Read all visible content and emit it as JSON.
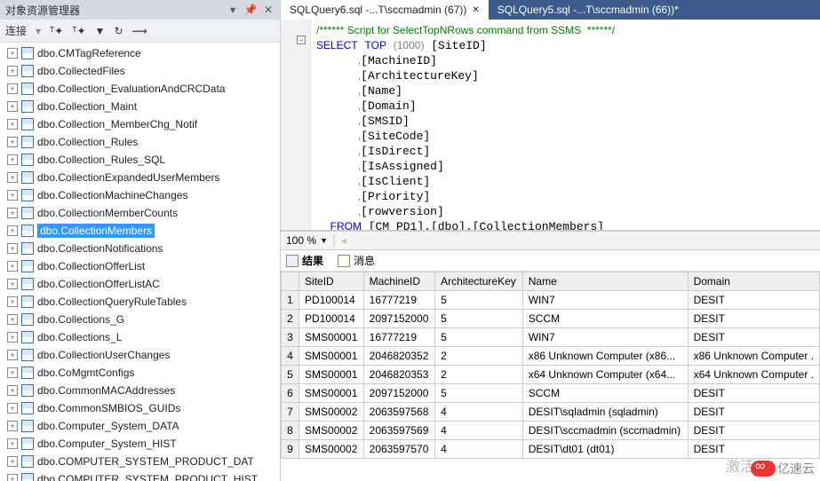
{
  "sidebar": {
    "title": "对象资源管理器",
    "connect_label": "连接",
    "items": [
      "dbo.CMTagReference",
      "dbo.CollectedFiles",
      "dbo.Collection_EvaluationAndCRCData",
      "dbo.Collection_Maint",
      "dbo.Collection_MemberChg_Notif",
      "dbo.Collection_Rules",
      "dbo.Collection_Rules_SQL",
      "dbo.CollectionExpandedUserMembers",
      "dbo.CollectionMachineChanges",
      "dbo.CollectionMemberCounts",
      "dbo.CollectionMembers",
      "dbo.CollectionNotifications",
      "dbo.CollectionOfferList",
      "dbo.CollectionOfferListAC",
      "dbo.CollectionQueryRuleTables",
      "dbo.Collections_G",
      "dbo.Collections_L",
      "dbo.CollectionUserChanges",
      "dbo.CoMgmtConfigs",
      "dbo.CommonMACAddresses",
      "dbo.CommonSMBIOS_GUIDs",
      "dbo.Computer_System_DATA",
      "dbo.Computer_System_HIST",
      "dbo.COMPUTER_SYSTEM_PRODUCT_DAT",
      "dbo.COMPUTER_SYSTEM_PRODUCT_HIST"
    ],
    "selected_index": 10
  },
  "tabs": [
    {
      "label": "SQLQuery6.sql -...T\\sccmadmin (67))",
      "active": true
    },
    {
      "label": "SQLQuery5.sql -...T\\sccmadmin (66))*",
      "active": false
    }
  ],
  "sql": {
    "comment": "/****** Script for SelectTopNRows command from SSMS  ******/",
    "select": "SELECT",
    "top": "TOP",
    "topn": "(1000)",
    "cols": [
      "[SiteID]",
      "[MachineID]",
      "[ArchitectureKey]",
      "[Name]",
      "[Domain]",
      "[SMSID]",
      "[SiteCode]",
      "[IsDirect]",
      "[IsAssigned]",
      "[IsClient]",
      "[Priority]",
      "[rowversion]"
    ],
    "from": "FROM",
    "source": "[CM_PD1].[dbo].[CollectionMembers]"
  },
  "zoom": "100 %",
  "result_tabs": {
    "results": "结果",
    "messages": "消息"
  },
  "grid": {
    "headers": [
      "SiteID",
      "MachineID",
      "ArchitectureKey",
      "Name",
      "Domain"
    ],
    "rows": [
      [
        "PD100014",
        "16777219",
        "5",
        "WIN7",
        "DESIT"
      ],
      [
        "PD100014",
        "2097152000",
        "5",
        "SCCM",
        "DESIT"
      ],
      [
        "SMS00001",
        "16777219",
        "5",
        "WIN7",
        "DESIT"
      ],
      [
        "SMS00001",
        "2046820352",
        "2",
        "x86 Unknown Computer (x86...",
        "x86 Unknown Computer ."
      ],
      [
        "SMS00001",
        "2046820353",
        "2",
        "x64 Unknown Computer (x64...",
        "x64 Unknown Computer ."
      ],
      [
        "SMS00001",
        "2097152000",
        "5",
        "SCCM",
        "DESIT"
      ],
      [
        "SMS00002",
        "2063597568",
        "4",
        "DESIT\\sqladmin (sqladmin)",
        "DESIT"
      ],
      [
        "SMS00002",
        "2063597569",
        "4",
        "DESIT\\sccmadmin (sccmadmin)",
        "DESIT"
      ],
      [
        "SMS00002",
        "2063597570",
        "4",
        "DESIT\\dt01 (dt01)",
        "DESIT"
      ]
    ]
  },
  "watermark": {
    "activate": "激活",
    "brand": "亿速云"
  }
}
